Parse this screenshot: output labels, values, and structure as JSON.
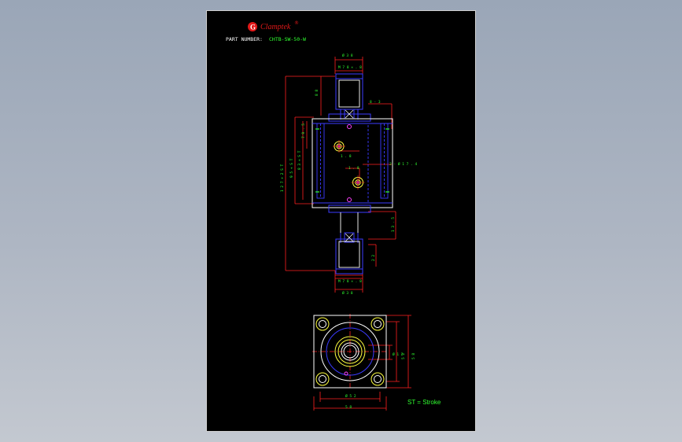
{
  "title_block": {
    "brand": "Clamptek",
    "brand_mark": "®",
    "part_number_label": "PART NUMBER:",
    "part_number_value": "CHTB-SW-50-W"
  },
  "front_view": {
    "dims": {
      "top_width": "Ø 3 8",
      "top_thread": "M 7 8 × . 8",
      "bottom_thread": "M 7 8 × . 8",
      "bottom_width": "Ø 3 8",
      "top_offset": "8 8",
      "left_overall": "1 2 7 + 2 S T",
      "left_inner": "9 5 + S T",
      "left_middle": "8 3 + S T",
      "left_small": "7 9 . 5",
      "right_top": "8 - 3",
      "right_lower": "1 3 . 5",
      "center_small": "1 . 8",
      "center_tol": "1 . 8",
      "side_callout": "2 - Ø 1 7 . 4",
      "right_side_lower": "2 2"
    }
  },
  "bottom_view": {
    "dims": {
      "dia_inner": "Ø 1 2",
      "dia_outer": "Ø 3 5",
      "height_1": "5 2",
      "height_2": "5 8",
      "width_1": "Ø 5 2",
      "width_2": "5 8"
    }
  },
  "note": "ST = Stroke",
  "colors": {
    "sheet": "#000000",
    "outline": "#ffffff",
    "blue": "#3b3bff",
    "red": "#ff2020",
    "yellow": "#ffff40",
    "green": "#30ff30",
    "magenta": "#ff40ff",
    "brand_red": "#e01818"
  }
}
